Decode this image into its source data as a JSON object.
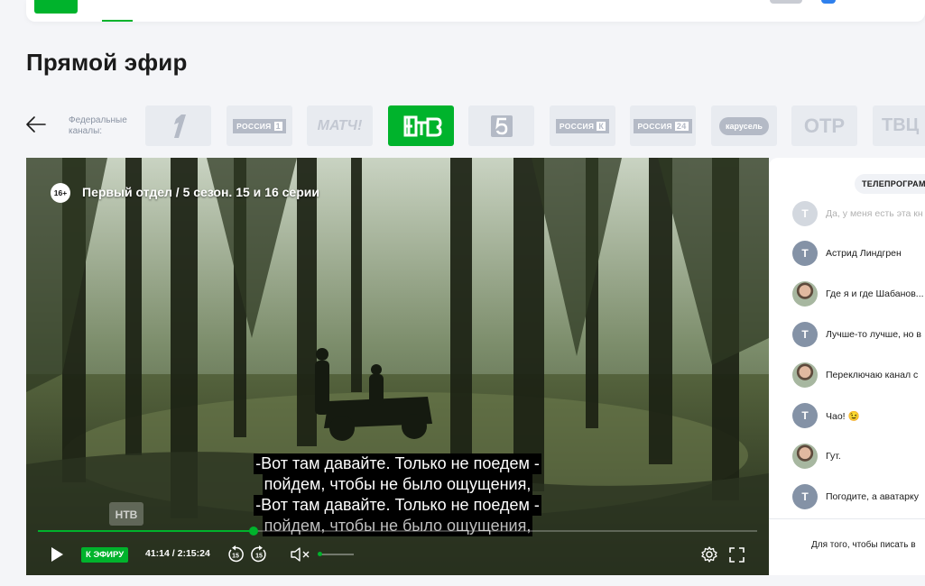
{
  "header": {
    "logo_name": "ntv-logo"
  },
  "page": {
    "title": "Прямой эфир"
  },
  "channels": {
    "label": "Федеральные каналы:",
    "items": [
      {
        "name": "Первый канал",
        "icon": "first-channel-logo"
      },
      {
        "name": "Россия 1",
        "badge": "РОССИЯ",
        "num": "1"
      },
      {
        "name": "Матч!",
        "text": "МАТЧ!"
      },
      {
        "name": "НТВ",
        "icon": "ntv-logo",
        "active": true
      },
      {
        "name": "Пятый канал",
        "icon": "channel-5-logo"
      },
      {
        "name": "Россия К",
        "badge": "РОССИЯ",
        "num": "К"
      },
      {
        "name": "Россия 24",
        "badge": "РОССИЯ",
        "num": "24"
      },
      {
        "name": "Карусель",
        "text": "карусель"
      },
      {
        "name": "ОТР",
        "text": "ОТР"
      },
      {
        "name": "ТВЦ",
        "text": "ТВЦ"
      }
    ]
  },
  "player": {
    "rating": "16+",
    "title": "Первый отдел / 5 сезон. 15 и 16 серии",
    "subtitles": [
      "-Вот там давайте. Только не поедем -",
      "пойдем, чтобы не было ощущения,",
      "-Вот там давайте. Только не поедем -",
      "пойдем, чтобы не было ощущения,"
    ],
    "live_label": "К ЭФИРУ",
    "time": "41:14 / 2:15:24",
    "progress": 0.3,
    "volume": 0.05,
    "muted": true,
    "accent": "#00b32c"
  },
  "side": {
    "tv_program_label": "ТЕЛЕПРОГРАММА",
    "messages": [
      {
        "initial": "Т",
        "text": "Да, у меня есть эта кн",
        "faded": true
      },
      {
        "initial": "Т",
        "text": "Астрид Линдгрен"
      },
      {
        "initial": "",
        "photo": true,
        "text": "Где я и где Шабанов..."
      },
      {
        "initial": "Т",
        "text": "Лучше-то лучше, но в"
      },
      {
        "initial": "",
        "photo": true,
        "text": "Переключаю канал с"
      },
      {
        "initial": "Т",
        "text": "Чао! 😉"
      },
      {
        "initial": "",
        "photo": true,
        "text": "Гут."
      },
      {
        "initial": "Т",
        "text": "Погодите, а аватарку"
      }
    ],
    "footer": "Для того, чтобы писать в"
  }
}
